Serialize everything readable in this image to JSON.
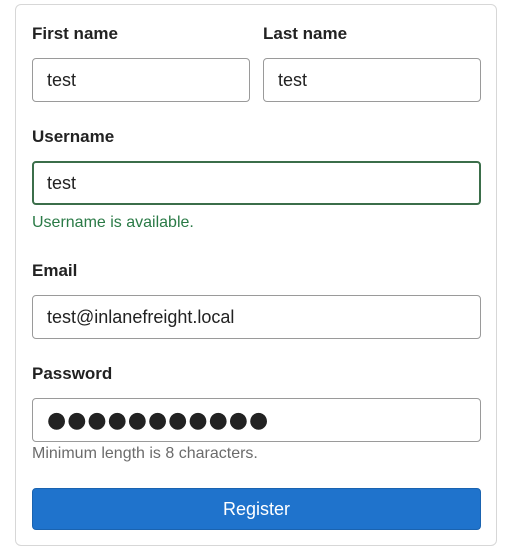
{
  "form": {
    "first_name": {
      "label": "First name",
      "value": "test"
    },
    "last_name": {
      "label": "Last name",
      "value": "test"
    },
    "username": {
      "label": "Username",
      "value": "test",
      "status": "Username is available."
    },
    "email": {
      "label": "Email",
      "value": "test@inlanefreight.local"
    },
    "password": {
      "label": "Password",
      "value": "●●●●●●●●●●●",
      "hint": "Minimum length is 8 characters."
    },
    "submit_label": "Register"
  },
  "colors": {
    "primary": "#1f73cc",
    "success": "#2a7a46",
    "valid_border": "#3b6e4a"
  }
}
